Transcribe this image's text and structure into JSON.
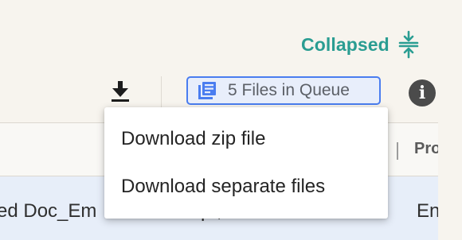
{
  "collapse_toggle": {
    "label": "Collapsed",
    "icon": "collapse-vertical-icon",
    "color": "#2a9d92"
  },
  "toolbar": {
    "download_icon": "download-icon",
    "queue_badge": {
      "icon": "file-list-icon",
      "label": "5 Files in Queue",
      "border_color": "#4a7df0"
    },
    "info_icon": "info-icon",
    "info_glyph": "i"
  },
  "dropdown": {
    "items": [
      {
        "label": "Download zip file"
      },
      {
        "label": "Download separate files"
      }
    ]
  },
  "table": {
    "visible_header": "Pro",
    "row": {
      "name_fragment": "ed Doc_Em",
      "middle_fragment": "p         ,",
      "product_fragment": "En"
    }
  }
}
